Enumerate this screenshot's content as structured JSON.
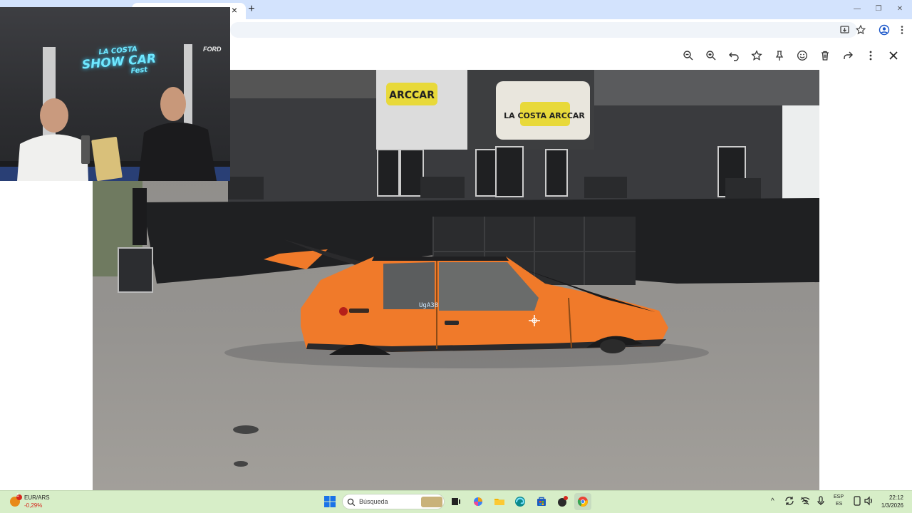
{
  "browser": {
    "new_tab_glyph": "+",
    "close_tab_glyph": "×",
    "window_controls": [
      "—",
      "❐",
      "✕"
    ],
    "toolbar_icons": [
      "install-app-icon",
      "star-icon",
      "profile-icon",
      "menu-icon"
    ]
  },
  "viewer_toolbar": {
    "buttons": [
      {
        "name": "zoom-out-icon",
        "glyph": "−"
      },
      {
        "name": "zoom-in-icon",
        "glyph": "+"
      },
      {
        "name": "undo-icon",
        "glyph": "↶"
      },
      {
        "name": "favorite-star-icon",
        "glyph": "☆"
      },
      {
        "name": "pin-icon",
        "glyph": "⚲"
      },
      {
        "name": "emoji-icon",
        "glyph": "☺"
      },
      {
        "name": "trash-icon",
        "glyph": "🗑"
      },
      {
        "name": "share-icon",
        "glyph": "↷"
      },
      {
        "name": "more-options-icon",
        "glyph": "⋮"
      },
      {
        "name": "close-viewer-icon",
        "glyph": "✕"
      }
    ]
  },
  "photo": {
    "car_color": "#f07a2a",
    "plate_text": "UgA38",
    "screens": [
      "ARCCAR",
      "LA COSTA ARCCAR"
    ]
  },
  "webcam": {
    "neon_sign_line1": "LA COSTA",
    "neon_sign_line2": "SHOW CAR",
    "neon_sign_line3": "Fest",
    "wall_brand": "FORD",
    "neon_color": "#6fe8ff"
  },
  "taskbar": {
    "ticker_label": "EUR/ARS",
    "ticker_value": "-0,29%",
    "ticker_badge": "1",
    "search_placeholder": "Búsqueda",
    "language_top": "ESP",
    "language_bottom": "ES",
    "time": "22:12",
    "date": "1/3/2026"
  },
  "colors": {
    "tabstrip": "#d3e3fd",
    "taskbar": "#d7eec8",
    "accent_down": "#d6281e"
  }
}
